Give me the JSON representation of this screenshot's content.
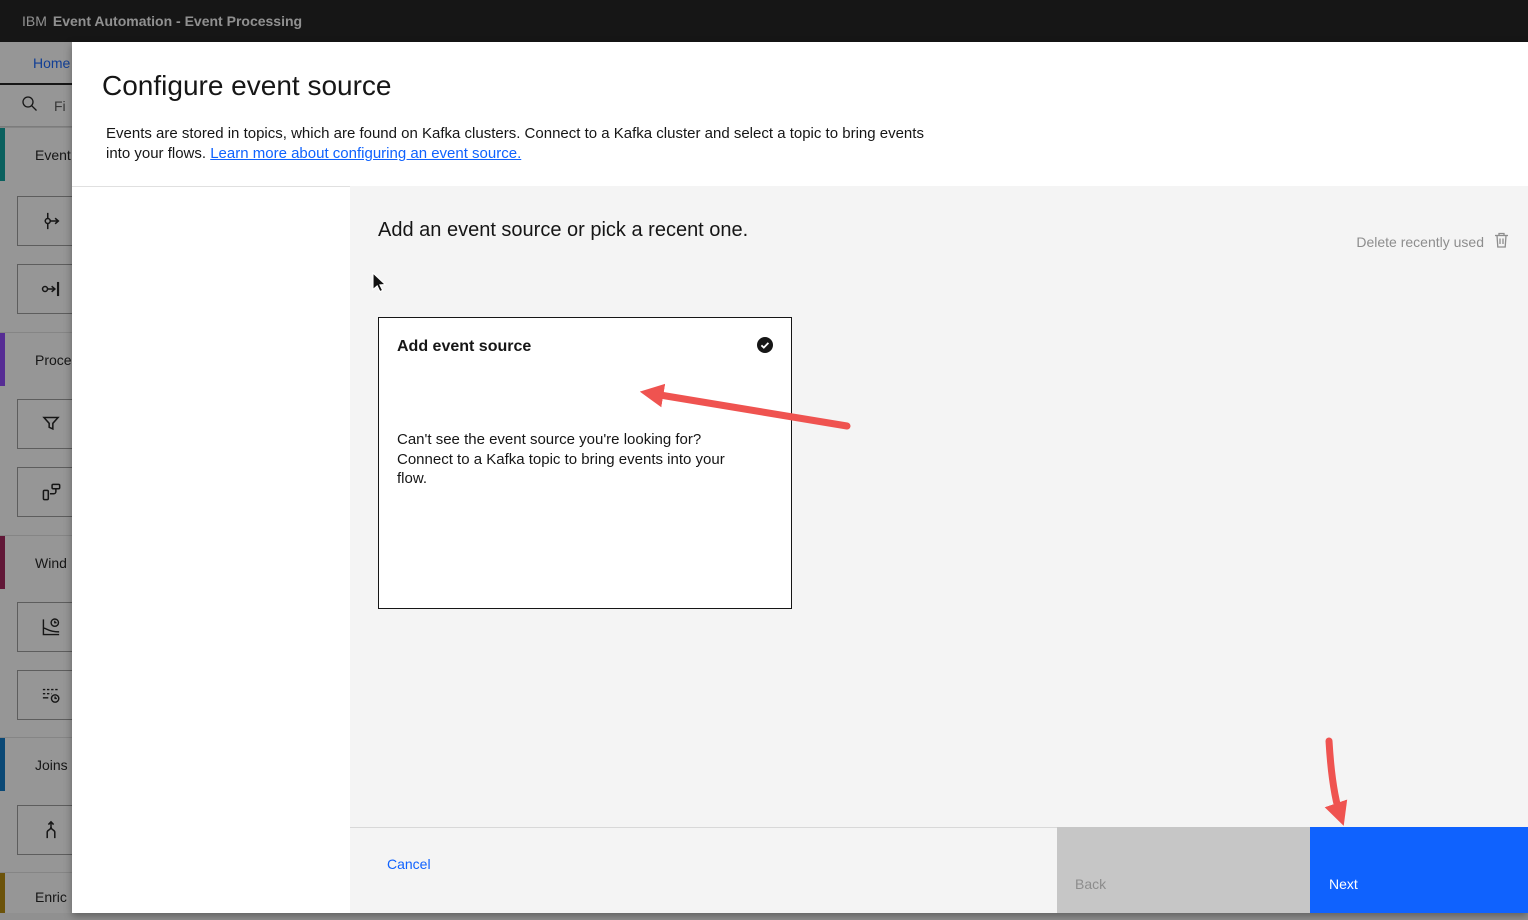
{
  "header": {
    "brand": "IBM",
    "product": "Event Automation - Event Processing"
  },
  "sidebar": {
    "home_label": "Home",
    "search_placeholder": "Fi",
    "sections": [
      {
        "label": "Event",
        "color": "#009d9a"
      },
      {
        "label": "Proce",
        "color": "#8a3ffc"
      },
      {
        "label": "Wind",
        "color": "#9f1853"
      },
      {
        "label": "Joins",
        "color": "#0072c3"
      },
      {
        "label": "Enric",
        "color": "#b28600"
      }
    ],
    "palette_icons": [
      "source",
      "destination",
      "filter",
      "transform",
      "window-aggregate",
      "window-top-n",
      "join"
    ]
  },
  "modal": {
    "title": "Configure event source",
    "description": "Events are stored in topics, which are found on Kafka clusters. Connect to a Kafka cluster and select a topic to bring events into your flows.",
    "learn_more_link": "Learn more about configuring an event source.",
    "panel": {
      "heading": "Add an event source or pick a recent one.",
      "delete_recent_label": "Delete recently used",
      "card": {
        "title": "Add event source",
        "body": "Can't see the event source you're looking for? Connect to a Kafka topic to bring events into your flow.",
        "selected": true
      }
    },
    "footer": {
      "cancel_label": "Cancel",
      "back_label": "Back",
      "next_label": "Next"
    }
  },
  "annotations": {
    "arrow_color": "#ef5350"
  },
  "colors": {
    "accent_blue": "#0f62fe",
    "header_bg": "#161616",
    "panel_bg": "#f4f4f4",
    "disabled_bg": "#c6c6c6",
    "disabled_text": "#8d8d8d"
  }
}
